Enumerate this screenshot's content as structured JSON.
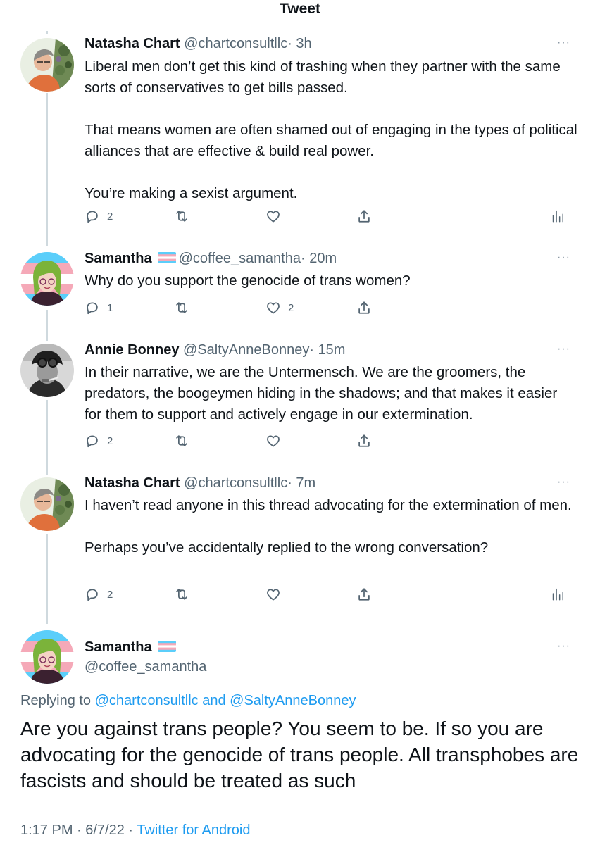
{
  "header": {
    "title": "Tweet"
  },
  "tweets": [
    {
      "name": "Natasha Chart",
      "handle": "@chartconsultllc",
      "time": "· 3h",
      "text": "Liberal men don’t get this kind of trashing when they partner with the same sorts of conservatives to get bills passed.\n\nThat means women are often shamed out of engaging in the types of political alliances that are effective & build real power.\n\nYou’re making a sexist argument.",
      "replies": "2",
      "likes": "",
      "more": "···",
      "avatar_icon": "natasha-avatar"
    },
    {
      "name": "Samantha",
      "handle": "@coffee_samantha",
      "time": "· 20m",
      "text": "Why do you support the genocide of trans women?",
      "replies": "1",
      "likes": "2",
      "more": "···",
      "avatar_icon": "samantha-avatar"
    },
    {
      "name": "Annie Bonney",
      "handle": "@SaltyAnneBonney",
      "time": "· 15m",
      "text": "In their narrative, we are the Untermensch. We are the groomers, the predators, the boogeymen hiding in the shadows; and that makes it easier for them to support and actively engage in our extermination.",
      "replies": "2",
      "likes": "",
      "more": "···",
      "avatar_icon": "annie-avatar"
    },
    {
      "name": "Natasha Chart",
      "handle": "@chartconsultllc",
      "time": "· 7m",
      "text": "I haven’t read anyone in this thread advocating for the extermination of men.\n\nPerhaps you’ve accidentally replied to the wrong conversation?",
      "replies": "2",
      "likes": "",
      "more": "···",
      "avatar_icon": "natasha-avatar"
    }
  ],
  "main_tweet": {
    "name": "Samantha",
    "handle": "@coffee_samantha",
    "more": "···",
    "replying_prefix": "Replying to",
    "replying_user1": "@chartconsultllc",
    "replying_and": "and",
    "replying_user2": "@SaltyAnneBonney",
    "text": "Are you against trans people? You seem to be. If so you are advocating for the genocide of trans people. All transphobes are fascists and should be treated as such",
    "timestamp": "1:17 PM · 6/7/22 ·",
    "source": "Twitter for Android"
  },
  "colors": {
    "link": "#1d9bf0",
    "secondary_text": "#536471",
    "thread_line": "#cfd9de",
    "trans_flag_blue": "#5bcefa",
    "trans_flag_pink": "#f5a9b8"
  },
  "icons": [
    "reply-icon",
    "retweet-icon",
    "like-icon",
    "share-icon",
    "analytics-icon",
    "more-icon",
    "trans-flag-icon"
  ]
}
